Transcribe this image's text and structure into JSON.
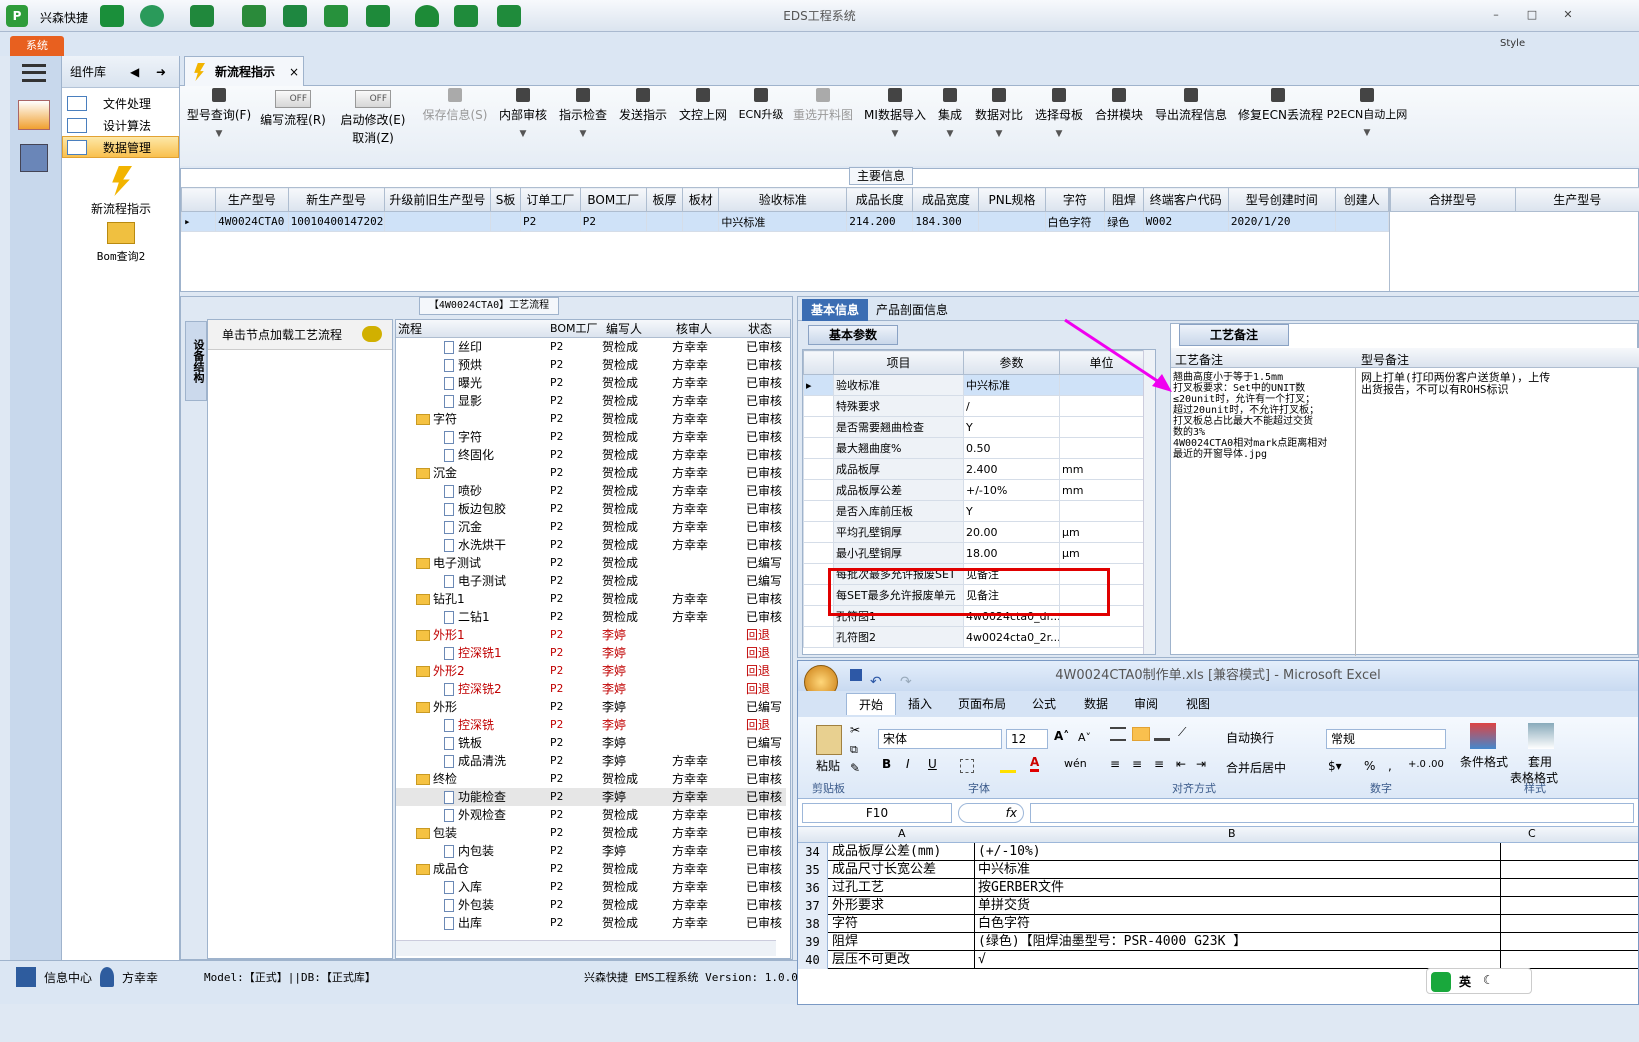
{
  "window": {
    "title": "EDS工程系统",
    "app_name": "兴森快捷",
    "style_label": "Style"
  },
  "menu": {
    "system_tab": "系统"
  },
  "component_lib": {
    "title": "组件库",
    "items": [
      {
        "label": "文件处理"
      },
      {
        "label": "设计算法"
      },
      {
        "label": "数据管理"
      }
    ],
    "shortcuts": [
      {
        "label": "新流程指示"
      },
      {
        "label": "Bom查询2"
      }
    ]
  },
  "tab": {
    "label": "新流程指示",
    "close": "×"
  },
  "ribbon": [
    {
      "label": "型号查询(F)"
    },
    {
      "label": "编写流程(R)",
      "toggle": "OFF"
    },
    {
      "label": "启动修改(E)",
      "label2": "取消(Z)",
      "toggle": "OFF"
    },
    {
      "label": "保存信息(S)"
    },
    {
      "label": "内部审核"
    },
    {
      "label": "指示检查"
    },
    {
      "label": "发送指示"
    },
    {
      "label": "文控上网"
    },
    {
      "label": "ECN升级"
    },
    {
      "label": "重选开料图"
    },
    {
      "label": "MI数据导入"
    },
    {
      "label": "集成"
    },
    {
      "label": "数据对比"
    },
    {
      "label": "选择母板"
    },
    {
      "label": "合拼模块"
    },
    {
      "label": "导出流程信息"
    },
    {
      "label": "修复ECN丢流程"
    },
    {
      "label": "P2ECN自动上网"
    }
  ],
  "main_info": {
    "title": "主要信息",
    "columns": [
      "生产型号",
      "新生产型号",
      "升级前旧生产型号",
      "S板",
      "订单工厂",
      "BOM工厂",
      "板厚",
      "板材",
      "验收标准",
      "成品长度",
      "成品宽度",
      "PNL规格",
      "字符",
      "阻焊",
      "终端客户代码",
      "型号创建时间",
      "创建人"
    ],
    "row": [
      "4W0024CTA0",
      "10010400147202",
      "",
      "",
      "P2",
      "P2",
      "",
      "",
      "中兴标准",
      "214.200",
      "184.300",
      "",
      "白色字符",
      "绿色",
      "W002",
      "2020/1/20",
      ""
    ],
    "side_columns": [
      "合拼型号",
      "生产型号"
    ]
  },
  "flow": {
    "title": "【4W0024CTA0】工艺流程",
    "side_label": "设备结构",
    "hint": "单击节点加载工艺流程",
    "columns": [
      "流程",
      "BOM工厂",
      "编写人",
      "核审人",
      "状态"
    ],
    "rows": [
      {
        "name": "丝印",
        "level": 2,
        "bom": "P2",
        "writer": "贺检成",
        "checker": "方幸幸",
        "status": "已审核"
      },
      {
        "name": "预烘",
        "level": 2,
        "bom": "P2",
        "writer": "贺检成",
        "checker": "方幸幸",
        "status": "已审核"
      },
      {
        "name": "曝光",
        "level": 2,
        "bom": "P2",
        "writer": "贺检成",
        "checker": "方幸幸",
        "status": "已审核"
      },
      {
        "name": "显影",
        "level": 2,
        "bom": "P2",
        "writer": "贺检成",
        "checker": "方幸幸",
        "status": "已审核"
      },
      {
        "name": "字符",
        "level": 1,
        "bom": "P2",
        "writer": "贺检成",
        "checker": "方幸幸",
        "status": "已审核"
      },
      {
        "name": "字符",
        "level": 2,
        "bom": "P2",
        "writer": "贺检成",
        "checker": "方幸幸",
        "status": "已审核"
      },
      {
        "name": "终固化",
        "level": 2,
        "bom": "P2",
        "writer": "贺检成",
        "checker": "方幸幸",
        "status": "已审核"
      },
      {
        "name": "沉金",
        "level": 1,
        "bom": "P2",
        "writer": "贺检成",
        "checker": "方幸幸",
        "status": "已审核"
      },
      {
        "name": "喷砂",
        "level": 2,
        "bom": "P2",
        "writer": "贺检成",
        "checker": "方幸幸",
        "status": "已审核"
      },
      {
        "name": "板边包胶",
        "level": 2,
        "bom": "P2",
        "writer": "贺检成",
        "checker": "方幸幸",
        "status": "已审核"
      },
      {
        "name": "沉金",
        "level": 2,
        "bom": "P2",
        "writer": "贺检成",
        "checker": "方幸幸",
        "status": "已审核"
      },
      {
        "name": "水洗烘干",
        "level": 2,
        "bom": "P2",
        "writer": "贺检成",
        "checker": "方幸幸",
        "status": "已审核"
      },
      {
        "name": "电子测试",
        "level": 1,
        "bom": "P2",
        "writer": "贺检成",
        "checker": "",
        "status": "已编写"
      },
      {
        "name": "电子测试",
        "level": 2,
        "bom": "P2",
        "writer": "贺检成",
        "checker": "",
        "status": "已编写"
      },
      {
        "name": "钻孔1",
        "level": 1,
        "bom": "P2",
        "writer": "贺检成",
        "checker": "方幸幸",
        "status": "已审核"
      },
      {
        "name": "二钻1",
        "level": 2,
        "bom": "P2",
        "writer": "贺检成",
        "checker": "方幸幸",
        "status": "已审核"
      },
      {
        "name": "外形1",
        "level": 1,
        "bom": "P2",
        "writer": "李婷",
        "checker": "",
        "status": "回退",
        "red": true
      },
      {
        "name": "控深铣1",
        "level": 2,
        "bom": "P2",
        "writer": "李婷",
        "checker": "",
        "status": "回退",
        "red": true
      },
      {
        "name": "外形2",
        "level": 1,
        "bom": "P2",
        "writer": "李婷",
        "checker": "",
        "status": "回退",
        "red": true
      },
      {
        "name": "控深铣2",
        "level": 2,
        "bom": "P2",
        "writer": "李婷",
        "checker": "",
        "status": "回退",
        "red": true
      },
      {
        "name": "外形",
        "level": 1,
        "bom": "P2",
        "writer": "李婷",
        "checker": "",
        "status": "已编写"
      },
      {
        "name": "控深铣",
        "level": 2,
        "bom": "P2",
        "writer": "李婷",
        "checker": "",
        "status": "回退",
        "red": true
      },
      {
        "name": "铣板",
        "level": 2,
        "bom": "P2",
        "writer": "李婷",
        "checker": "",
        "status": "已编写"
      },
      {
        "name": "成品清洗",
        "level": 2,
        "bom": "P2",
        "writer": "李婷",
        "checker": "方幸幸",
        "status": "已审核"
      },
      {
        "name": "终检",
        "level": 1,
        "bom": "P2",
        "writer": "贺检成",
        "checker": "方幸幸",
        "status": "已审核"
      },
      {
        "name": "功能检查",
        "level": 2,
        "bom": "P2",
        "writer": "李婷",
        "checker": "方幸幸",
        "status": "已审核",
        "sel": true
      },
      {
        "name": "外观检查",
        "level": 2,
        "bom": "P2",
        "writer": "贺检成",
        "checker": "方幸幸",
        "status": "已审核"
      },
      {
        "name": "包装",
        "level": 1,
        "bom": "P2",
        "writer": "贺检成",
        "checker": "方幸幸",
        "status": "已审核"
      },
      {
        "name": "内包装",
        "level": 2,
        "bom": "P2",
        "writer": "李婷",
        "checker": "方幸幸",
        "status": "已审核"
      },
      {
        "name": "成品仓",
        "level": 1,
        "bom": "P2",
        "writer": "贺检成",
        "checker": "方幸幸",
        "status": "已审核"
      },
      {
        "name": "入库",
        "level": 2,
        "bom": "P2",
        "writer": "贺检成",
        "checker": "方幸幸",
        "status": "已审核"
      },
      {
        "name": "外包装",
        "level": 2,
        "bom": "P2",
        "writer": "贺检成",
        "checker": "方幸幸",
        "status": "已审核"
      },
      {
        "name": "出库",
        "level": 2,
        "bom": "P2",
        "writer": "贺检成",
        "checker": "方幸幸",
        "status": "已审核"
      }
    ]
  },
  "basic": {
    "tabs": [
      "基本信息",
      "产品剖面信息"
    ],
    "group": "基本参数",
    "columns": [
      "项目",
      "参数",
      "单位"
    ],
    "rows": [
      {
        "item": "验收标准",
        "value": "中兴标准",
        "unit": ""
      },
      {
        "item": "特殊要求",
        "value": "/",
        "unit": ""
      },
      {
        "item": "是否需要翘曲检查",
        "value": "Y",
        "unit": ""
      },
      {
        "item": "最大翘曲度%",
        "value": "0.50",
        "unit": ""
      },
      {
        "item": "成品板厚",
        "value": "2.400",
        "unit": "mm"
      },
      {
        "item": "成品板厚公差",
        "value": "+/-10%",
        "unit": "mm"
      },
      {
        "item": "是否入库前压板",
        "value": "Y",
        "unit": ""
      },
      {
        "item": "平均孔壁铜厚",
        "value": "20.00",
        "unit": "μm"
      },
      {
        "item": "最小孔壁铜厚",
        "value": "18.00",
        "unit": "μm"
      },
      {
        "item": "每批次最多允许报废SET",
        "value": "见备注",
        "unit": ""
      },
      {
        "item": "每SET最多允许报废单元",
        "value": "见备注",
        "unit": ""
      },
      {
        "item": "孔符图1",
        "value": "4w0024cta0_dr...",
        "unit": ""
      },
      {
        "item": "孔符图2",
        "value": "4w0024cta0_2r...",
        "unit": ""
      }
    ]
  },
  "remarks": {
    "tab": "工艺备注",
    "col1": "工艺备注",
    "col2": "型号备注",
    "text1": [
      "翘曲高度小于等于1.5mm",
      "打叉板要求：Set中的UNIT数",
      "≤20unit时，允许有一个打叉；",
      "超过20unit时，不允许打叉板；",
      "打叉板总占比最大不能超过交货",
      "数的3%",
      "4W0024CTA0相对mark点距离相对",
      "最近的开窗导体.jpg"
    ],
    "text2": [
      "网上打单(打印两份客户送货单)，上传",
      "出货报告，不可以有ROHS标识"
    ]
  },
  "excel": {
    "title": "4W0024CTA0制作单.xls  [兼容模式] - Microsoft Excel",
    "tabs": [
      "开始",
      "插入",
      "页面布局",
      "公式",
      "数据",
      "审阅",
      "视图"
    ],
    "font": "宋体",
    "size": "12",
    "number_format": "常规",
    "wrap": "自动换行",
    "merge": "合并后居中",
    "paste": "粘贴",
    "cond": "条件格式",
    "table": "套用",
    "table2": "表格格式",
    "groups": [
      "剪贴板",
      "字体",
      "对齐方式",
      "数字",
      "样式"
    ],
    "cell_ref": "F10",
    "fx": "fx",
    "col_headers": [
      "A",
      "B",
      "C"
    ],
    "rows": [
      {
        "n": "34",
        "a": "成品板厚公差(mm)",
        "b": "(+/-10%)"
      },
      {
        "n": "35",
        "a": "成品尺寸长宽公差",
        "b": "中兴标准"
      },
      {
        "n": "36",
        "a": "过孔工艺",
        "b": "按GERBER文件"
      },
      {
        "n": "37",
        "a": "外形要求",
        "b": "单拼交货"
      },
      {
        "n": "38",
        "a": "字符",
        "b": "白色字符"
      },
      {
        "n": "39",
        "a": "阻焊",
        "b": "(绿色)【阻焊油墨型号：PSR-4000 G23K 】"
      },
      {
        "n": "40",
        "a": "层压不可更改",
        "b": "√"
      }
    ]
  },
  "statusbar": {
    "info": "信息中心",
    "user": "方幸幸",
    "model": "Model:【正式】||DB:【正式库】",
    "version": "兴森快捷 EMS工程系统  Version: 1.0.0"
  },
  "ime": {
    "lang": "英"
  }
}
